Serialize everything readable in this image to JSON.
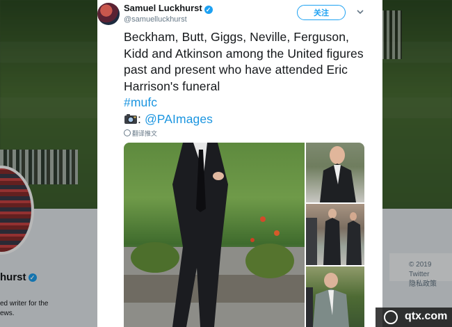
{
  "profile": {
    "name_partial": "hurst",
    "bio_line1": "ed writer for the",
    "bio_line2": "ews."
  },
  "footer": {
    "copyright": "© 2019 Twitter",
    "privacy": "隐私政策"
  },
  "tweet": {
    "author_name": "Samuel Luckhurst",
    "handle": "@samuelluckhurst",
    "follow_label": "关注",
    "text_main": "Beckham, Butt, Giggs, Neville, Ferguson, Kidd and Atkinson among the United figures past and present who have attended Eric Harrison's funeral",
    "hashtag": "#mufc",
    "colon": ":",
    "mention": "@PAImages",
    "translate_label": "翻译推文"
  },
  "watermark": {
    "text": "qtx.com"
  },
  "colors": {
    "accent": "#1da1f2",
    "link": "#1b95e0"
  }
}
